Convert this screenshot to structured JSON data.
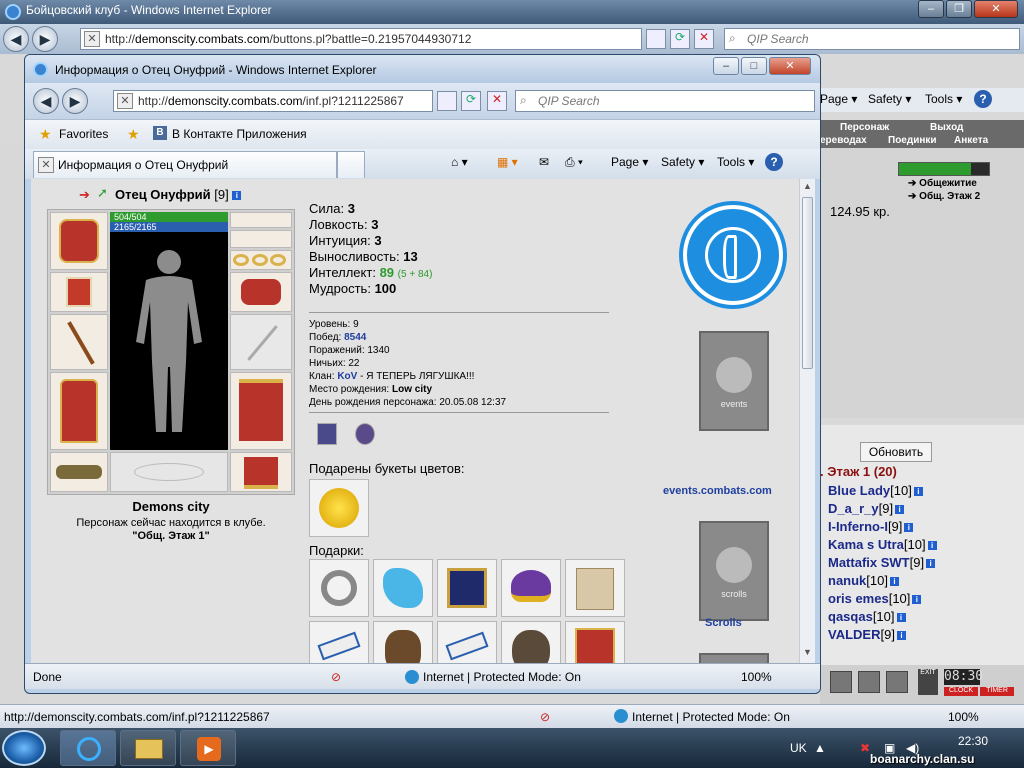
{
  "outer": {
    "title": "Бойцовский клуб - Windows Internet Explorer",
    "address_prefix": "http://",
    "address_host": "demonscity.combats.com",
    "address_path": "/buttons.pl?battle=0.21957044930712",
    "search_placeholder": "QIP Search",
    "cmd_page": "Page ▾",
    "cmd_safety": "Safety ▾",
    "cmd_tools": "Tools ▾",
    "status_url": "http://demonscity.combats.com/inf.pl?1211225867",
    "status_zone": "Internet | Protected Mode: On",
    "status_zoom": "100%",
    "bg_tabs": {
      "character": "Персонаж",
      "exit": "Выход",
      "transfers": "ереводах",
      "fights": "Поединки",
      "survey": "Анкета"
    },
    "bg_location1": "Общежитие",
    "bg_location2": "Общ. Этаж 2",
    "bg_money": "124.95 кр.",
    "bg_refresh": "Обновить",
    "bg_room": ". Этаж 1 (20)",
    "chat_users": [
      {
        "name": "Blue Lady",
        "level": "[10]"
      },
      {
        "name": "D_a_r_y",
        "level": "[9]"
      },
      {
        "name": "I-Inferno-I",
        "level": "[9]"
      },
      {
        "name": "Kama s Utra",
        "level": "[10]"
      },
      {
        "name": "Mattafix SWT",
        "level": "[9]"
      },
      {
        "name": "nanuk",
        "level": "[10]"
      },
      {
        "name": "oris emes",
        "level": "[10]"
      },
      {
        "name": "qasqas",
        "level": "[10]"
      },
      {
        "name": "VALDER",
        "level": "[9]"
      }
    ],
    "clock": "08:30",
    "clock_label": "CLOCK",
    "timer_label": "TIMER",
    "exit_label": "EXIT"
  },
  "taskbar": {
    "lang": "UK",
    "time": "22:30",
    "watermark": "boanarchy.clan.su"
  },
  "inner": {
    "title": "Информация о Отец Онуфрий - Windows Internet Explorer",
    "address_prefix": "http://",
    "address_host": "demonscity.combats.com",
    "address_path": "/inf.pl?1211225867",
    "search_placeholder": "QIP Search",
    "favorites": "Favorites",
    "fav_vk": "В Контакте",
    "fav_apps": "Приложения",
    "tab_title": "Информация о Отец Онуфрий",
    "cmd_page": "Page",
    "cmd_safety": "Safety",
    "cmd_tools": "Tools",
    "status_done": "Done",
    "status_zone": "Internet | Protected Mode: On",
    "status_zoom": "100%"
  },
  "character": {
    "name": "Отец Онуфрий",
    "level": "[9]",
    "hp": "504/504",
    "mana": "2165/2165",
    "hp_fraction": 1.0,
    "mana_fraction": 1.0,
    "city": "Demons city",
    "location_text": "Персонаж сейчас находится в клубе.",
    "location_room": "\"Общ. Этаж 1\"",
    "stats": [
      {
        "label": "Сила:",
        "value": "3",
        "extra": ""
      },
      {
        "label": "Ловкость:",
        "value": "3",
        "extra": ""
      },
      {
        "label": "Интуиция:",
        "value": "3",
        "extra": ""
      },
      {
        "label": "Выносливость:",
        "value": "13",
        "extra": ""
      },
      {
        "label": "Интеллект:",
        "value": "89",
        "extra": "(5 + 84)"
      },
      {
        "label": "Мудрость:",
        "value": "100",
        "extra": ""
      }
    ],
    "level_line": "Уровень: 9",
    "wins_label": "Побед:",
    "wins": "8544",
    "losses": "Поражений: 1340",
    "draws": "Ничьих: 22",
    "clan_label": "Клан:",
    "clan": "KoV",
    "clan_motto": " - Я ТЕПЕРЬ ЛЯГУШКА!!!",
    "birthplace_label": "Место рождения:",
    "birthplace": "Low city",
    "birthday": "День рождения персонажа: 20.05.08 12:37",
    "flowers_heading": "Подарены букеты цветов:",
    "gifts_heading": "Подарки:"
  },
  "sidebar": {
    "events_link": "events.combats.com",
    "events_banner_text": "events",
    "scrolls_link": "Scrolls",
    "scrolls_banner_text": "scrolls"
  },
  "colors": {
    "hp": "#2e9b2e",
    "mana": "#2a5fb0",
    "link": "#1f3f9f",
    "intel": "#2c9a2c",
    "accent": "#1e8fe0"
  }
}
